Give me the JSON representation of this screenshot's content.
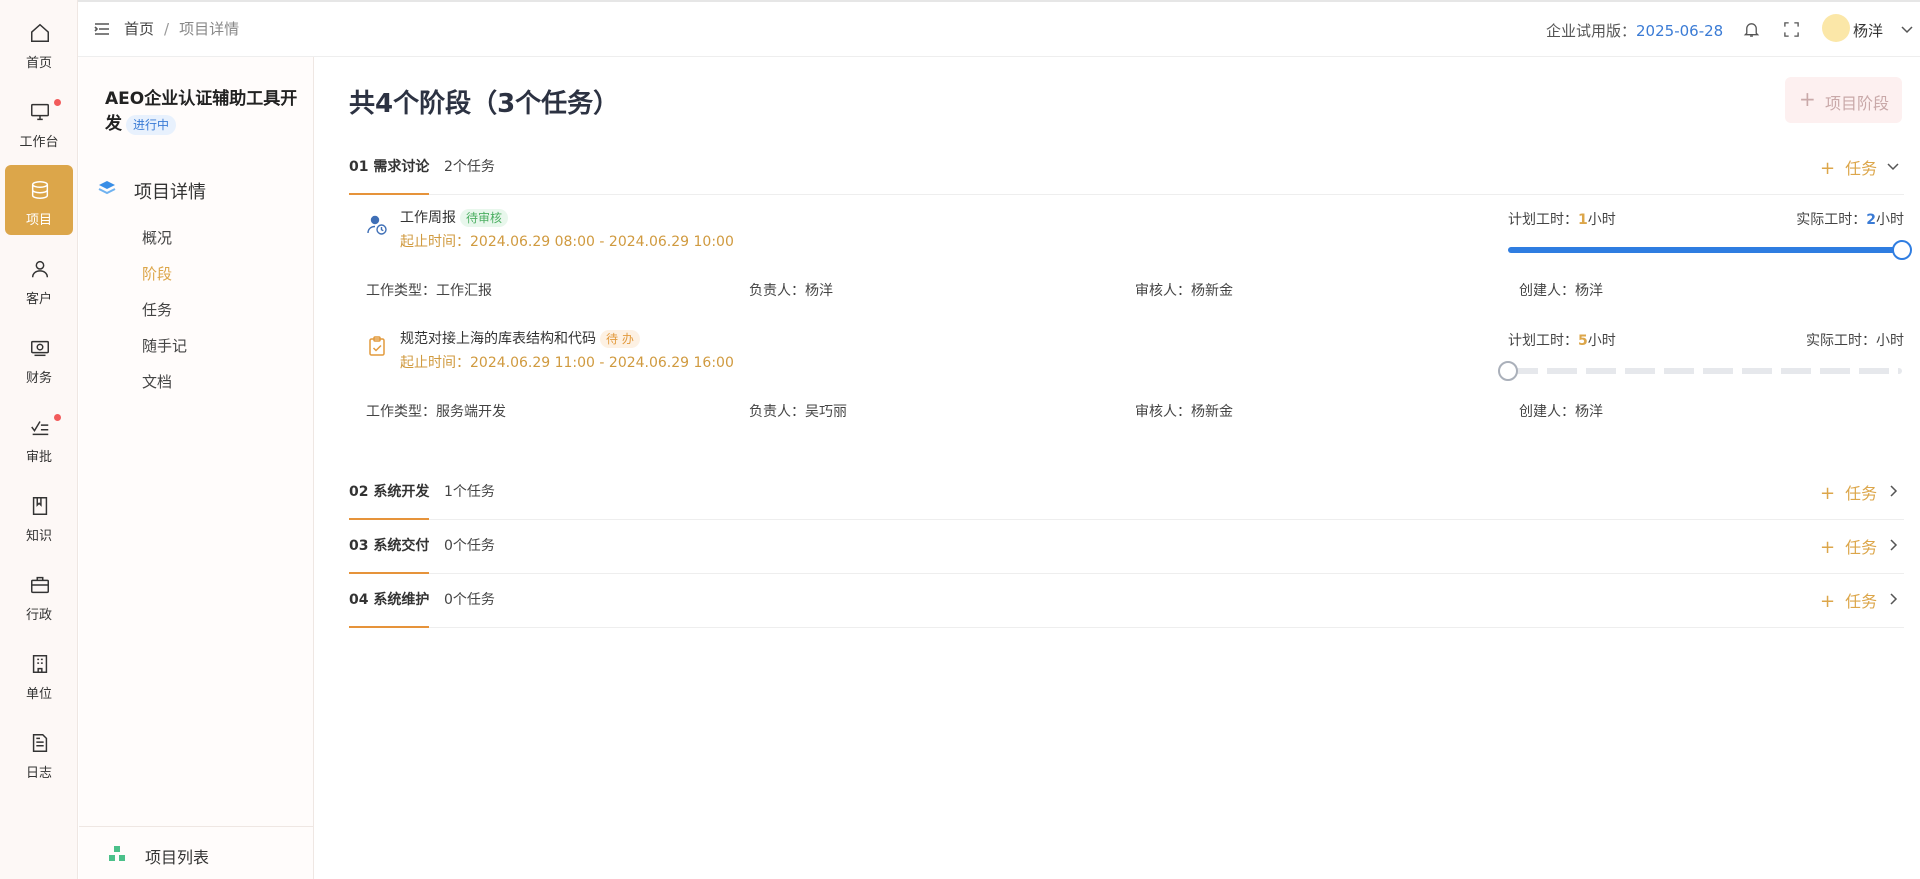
{
  "nav": {
    "items": [
      {
        "label": "首页",
        "icon": "home-icon"
      },
      {
        "label": "工作台",
        "icon": "monitor-icon",
        "dot": true
      },
      {
        "label": "项目",
        "icon": "database-icon",
        "active": true
      },
      {
        "label": "客户",
        "icon": "user-icon"
      },
      {
        "label": "财务",
        "icon": "finance-icon"
      },
      {
        "label": "审批",
        "icon": "approval-icon",
        "dot": true
      },
      {
        "label": "知识",
        "icon": "book-icon"
      },
      {
        "label": "行政",
        "icon": "briefcase-icon"
      },
      {
        "label": "单位",
        "icon": "building-icon"
      },
      {
        "label": "日志",
        "icon": "document-icon"
      }
    ]
  },
  "header": {
    "breadcrumb": [
      "首页",
      "项目详情"
    ],
    "trial_label": "企业试用版：",
    "trial_date": "2025-06-28",
    "user_name": "杨洋"
  },
  "side": {
    "project_title": "AEO企业认证辅助工具开发",
    "status": "进行中",
    "section_title": "项目详情",
    "links": [
      "概况",
      "阶段",
      "任务",
      "随手记",
      "文档"
    ],
    "active_link": "阶段",
    "footer": "项目列表"
  },
  "main": {
    "title": "共4个阶段（3个任务）",
    "add_stage_label": "项目阶段",
    "add_task_label": "任务",
    "stages": [
      {
        "name": "01 需求讨论",
        "count": "2个任务",
        "expanded": true
      },
      {
        "name": "02 系统开发",
        "count": "1个任务",
        "expanded": false
      },
      {
        "name": "03 系统交付",
        "count": "0个任务",
        "expanded": false
      },
      {
        "name": "04 系统维护",
        "count": "0个任务",
        "expanded": false
      }
    ],
    "tasks": [
      {
        "name": "工作周报",
        "status": "待审核",
        "time": "起止时间：2024.06.29 08:00 - 2024.06.29 10:00",
        "plan_prefix": "计划工时：",
        "plan_hours": "1",
        "actual_prefix": "实际工时：",
        "actual_hours": "2",
        "unit": "小时",
        "progress": 1.0,
        "type": "工作类型：工作汇报",
        "owner": "负责人：杨洋",
        "reviewer": "审核人：杨新金",
        "creator": "创建人：杨洋"
      },
      {
        "name": "规范对接上海的库表结构和代码",
        "status": "待 办",
        "time": "起止时间：2024.06.29 11:00 - 2024.06.29 16:00",
        "plan_prefix": "计划工时：",
        "plan_hours": "5",
        "actual_prefix": "实际工时：",
        "actual_hours": "",
        "unit": "小时",
        "progress": 0.0,
        "type": "工作类型：服务端开发",
        "owner": "负责人：吴巧丽",
        "reviewer": "审核人：杨新金",
        "creator": "创建人：杨洋"
      }
    ]
  },
  "colors": {
    "accent": "#dca64a",
    "blue": "#2f7de1",
    "stage_underline": "#e6933a"
  }
}
